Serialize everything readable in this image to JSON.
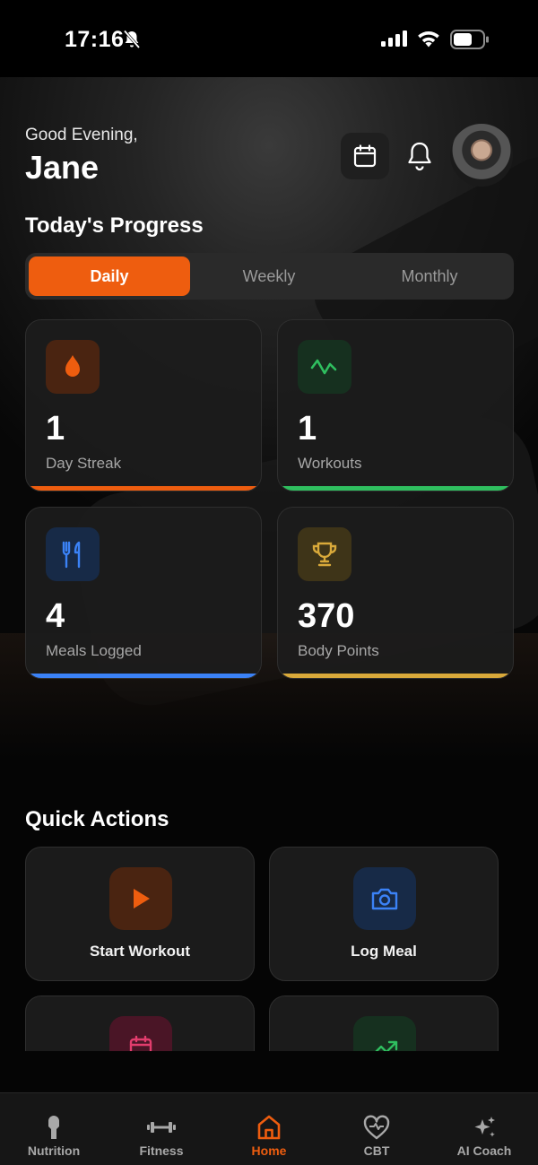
{
  "status_bar": {
    "time": "17:16"
  },
  "header": {
    "greeting": "Good Evening,",
    "user_name": "Jane"
  },
  "progress": {
    "title": "Today's Progress",
    "periods": [
      "Daily",
      "Weekly",
      "Monthly"
    ],
    "selected_period": "Daily",
    "stats": [
      {
        "value": "1",
        "label": "Day Streak",
        "icon": "flame-icon",
        "color": "#ee5d0f"
      },
      {
        "value": "1",
        "label": "Workouts",
        "icon": "activity-icon",
        "color": "#2fbf5f"
      },
      {
        "value": "4",
        "label": "Meals Logged",
        "icon": "utensils-icon",
        "color": "#3b82f6"
      },
      {
        "value": "370",
        "label": "Body Points",
        "icon": "trophy-icon",
        "color": "#d9a93a"
      }
    ]
  },
  "quick_actions": {
    "title": "Quick Actions",
    "items": [
      {
        "label": "Start Workout",
        "icon": "play-icon",
        "color": "#ee5d0f"
      },
      {
        "label": "Log Meal",
        "icon": "camera-icon",
        "color": "#3b82f6"
      }
    ]
  },
  "tab_bar": {
    "tabs": [
      {
        "label": "Nutrition",
        "icon": "nutrition-icon"
      },
      {
        "label": "Fitness",
        "icon": "dumbbell-icon"
      },
      {
        "label": "Home",
        "icon": "home-icon"
      },
      {
        "label": "CBT",
        "icon": "heart-pulse-icon"
      },
      {
        "label": "AI Coach",
        "icon": "sparkles-icon"
      }
    ],
    "active": "Home"
  },
  "colors": {
    "accent": "#ee5d0f",
    "background": "#050505"
  }
}
